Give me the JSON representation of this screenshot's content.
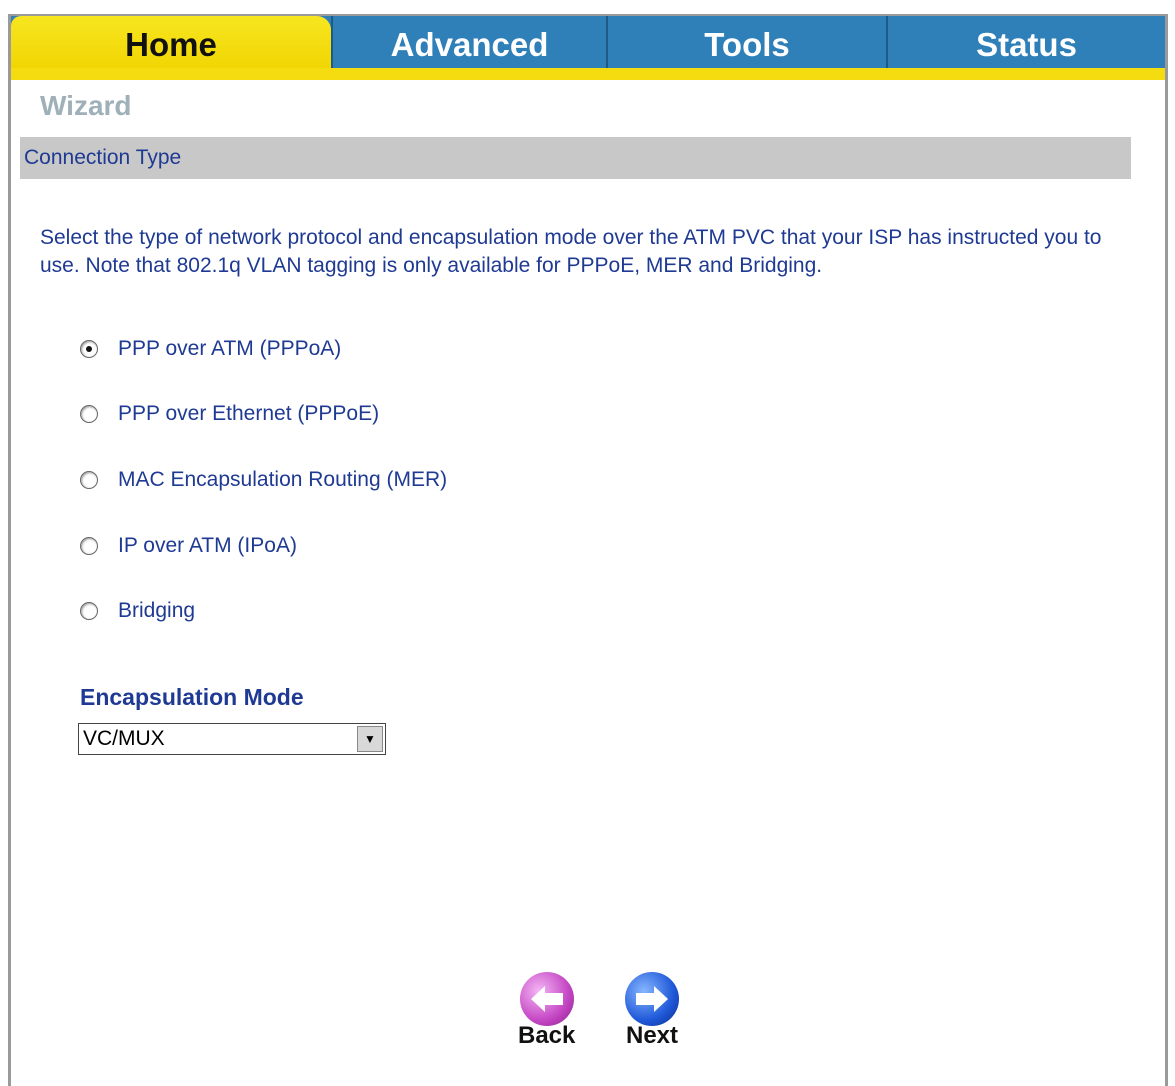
{
  "tabs": [
    {
      "label": "Home",
      "active": true
    },
    {
      "label": "Advanced",
      "active": false
    },
    {
      "label": "Tools",
      "active": false
    },
    {
      "label": "Status",
      "active": false
    }
  ],
  "page_title": "Wizard",
  "section_title": "Connection Type",
  "description": "Select the type of network protocol and encapsulation mode over the ATM PVC that your ISP has instructed you to use. Note that 802.1q VLAN tagging is only available for PPPoE, MER and Bridging.",
  "connection_types": [
    {
      "label": "PPP over ATM (PPPoA)",
      "checked": true
    },
    {
      "label": "PPP over Ethernet (PPPoE)",
      "checked": false
    },
    {
      "label": "MAC Encapsulation Routing (MER)",
      "checked": false
    },
    {
      "label": "IP over ATM (IPoA)",
      "checked": false
    },
    {
      "label": "Bridging",
      "checked": false
    }
  ],
  "encapsulation": {
    "label": "Encapsulation Mode",
    "selected": "VC/MUX"
  },
  "buttons": {
    "back_label": "Back",
    "next_label": "Next"
  },
  "colors": {
    "tab_active": "#f0d400",
    "tab_inactive": "#2f7fb8",
    "text": "#1f3a93",
    "section_bar": "#c8c8c8"
  },
  "icons": {
    "back": "back-arrow-icon",
    "next": "next-arrow-icon"
  }
}
